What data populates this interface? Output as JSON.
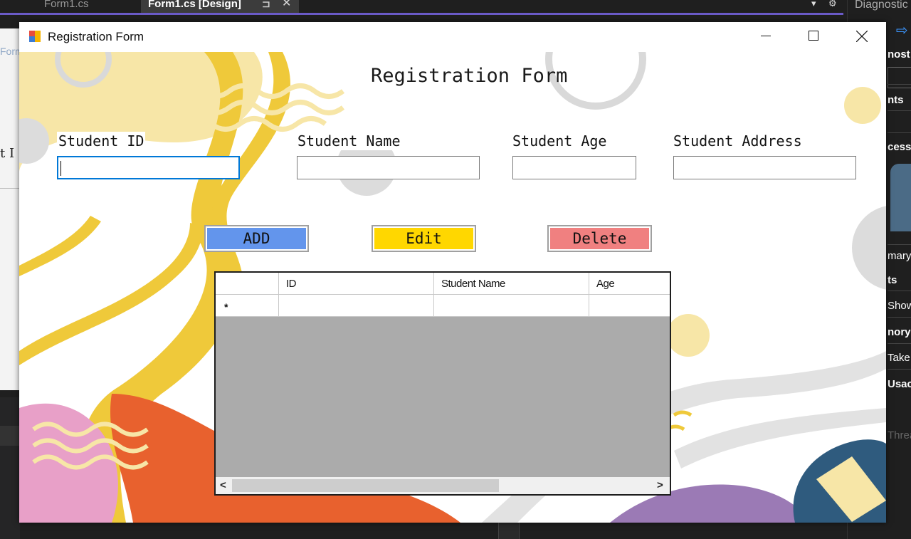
{
  "ide": {
    "tabs": [
      {
        "label": "Form1.cs"
      },
      {
        "label": "Form1.cs [Design]",
        "pin": "⊐",
        "close": "✕"
      }
    ],
    "controls": {
      "dropdown": "▾",
      "gear": "⚙"
    },
    "left_panel": {
      "label_top": "Form",
      "label_mid": "t I"
    },
    "right_panel": {
      "title": "Diagnostic",
      "items": [
        "nost",
        "nts",
        "cess",
        "mary",
        "ts",
        "Show",
        "nory",
        "Take",
        "Usac",
        "Threa"
      ]
    }
  },
  "window": {
    "title": "Registration Form",
    "controls": {
      "minimize": "Minimize",
      "maximize": "Maximize",
      "close": "Close"
    }
  },
  "form": {
    "heading": "Registration Form",
    "fields": [
      {
        "label": "Student ID",
        "value": ""
      },
      {
        "label": "Student Name",
        "value": ""
      },
      {
        "label": "Student Age",
        "value": ""
      },
      {
        "label": "Student Address",
        "value": ""
      }
    ],
    "buttons": {
      "add": "ADD",
      "edit": "Edit",
      "delete": "Delete"
    },
    "colors": {
      "add": "#6395ec",
      "edit": "#ffd700",
      "delete": "#f08080",
      "focus_border": "#0078d7"
    }
  },
  "grid": {
    "columns": [
      "",
      "ID",
      "Student Name",
      "Age"
    ],
    "new_row_marker": "*",
    "scroll": {
      "left": "<",
      "right": ">"
    }
  }
}
